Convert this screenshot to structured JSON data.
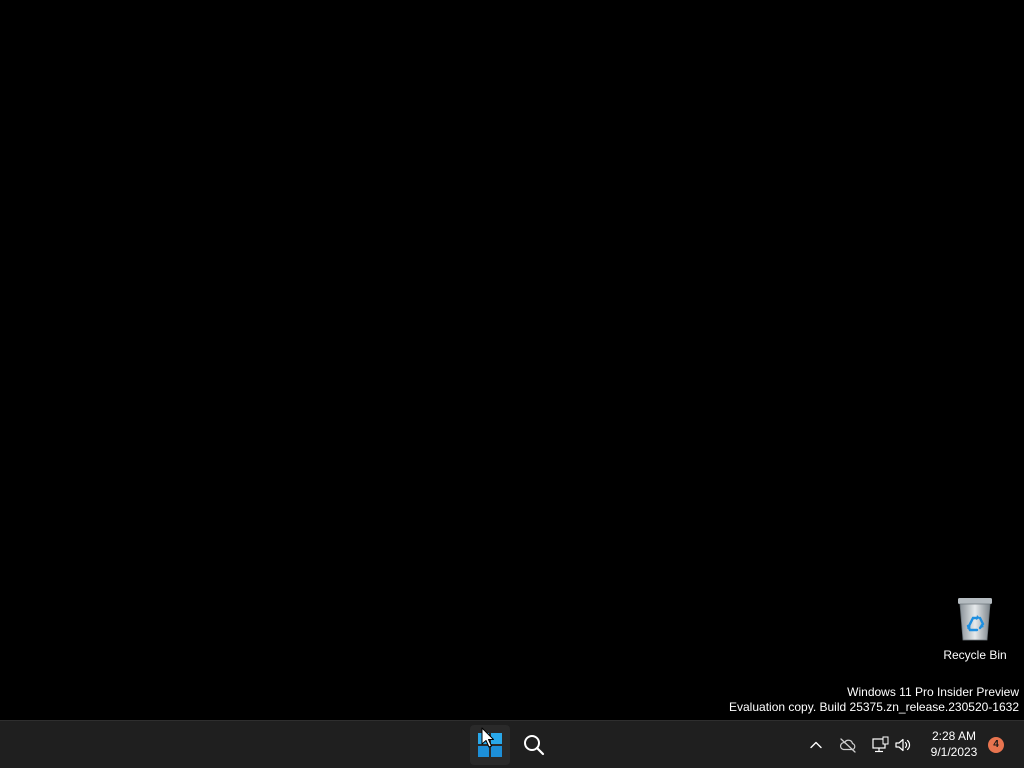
{
  "desktop": {
    "icons": [
      {
        "label": "Recycle Bin",
        "icon": "recycle-bin-icon"
      }
    ],
    "watermark": {
      "line1": "Windows 11 Pro Insider Preview",
      "line2": "Evaluation copy. Build 25375.zn_release.230520-1632"
    }
  },
  "taskbar": {
    "start_icon": "windows-logo-icon",
    "search_icon": "search-icon",
    "tray": {
      "icons": [
        "chevron-up-icon",
        "cloud-off-icon",
        "network-icon",
        "volume-icon"
      ],
      "time": "2:28 AM",
      "date": "9/1/2023",
      "notification_count": "4"
    }
  },
  "colors": {
    "desktop_bg": "#000000",
    "taskbar_bg": "#1f1f1f",
    "accent": "#29a8ea",
    "badge": "#e8744f"
  }
}
